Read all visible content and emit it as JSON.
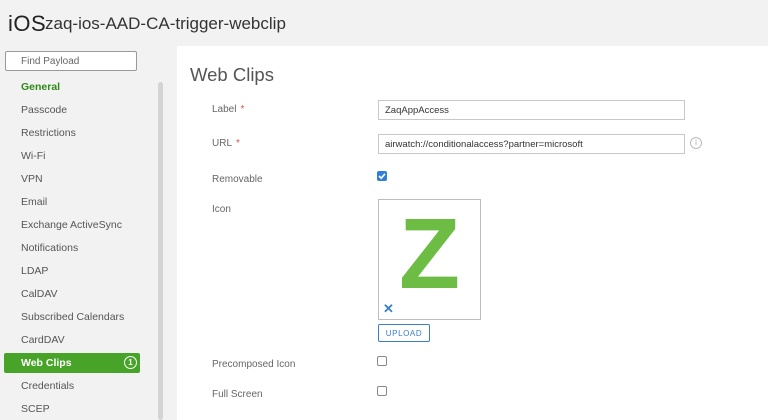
{
  "header": {
    "os_label": "iOS",
    "profile_name": "zaq-ios-AAD-CA-trigger-webclip"
  },
  "sidebar": {
    "search_placeholder": "Find Payload",
    "items": [
      {
        "label": "General"
      },
      {
        "label": "Passcode"
      },
      {
        "label": "Restrictions"
      },
      {
        "label": "Wi-Fi"
      },
      {
        "label": "VPN"
      },
      {
        "label": "Email"
      },
      {
        "label": "Exchange ActiveSync"
      },
      {
        "label": "Notifications"
      },
      {
        "label": "LDAP"
      },
      {
        "label": "CalDAV"
      },
      {
        "label": "Subscribed Calendars"
      },
      {
        "label": "CardDAV"
      },
      {
        "label": "Web Clips",
        "badge": "1"
      },
      {
        "label": "Credentials"
      },
      {
        "label": "SCEP"
      }
    ]
  },
  "main": {
    "title": "Web Clips",
    "fields": {
      "label": {
        "label": "Label",
        "required": "*",
        "value": "ZaqAppAccess"
      },
      "url": {
        "label": "URL",
        "required": "*",
        "value": "airwatch://conditionalaccess?partner=microsoft",
        "info_icon": "info-icon"
      },
      "removable": {
        "label": "Removable",
        "checked": true
      },
      "icon": {
        "label": "Icon",
        "preview_letter": "Z",
        "remove_icon": "close-icon",
        "upload_label": "UPLOAD"
      },
      "precomposed": {
        "label": "Precomposed Icon",
        "checked": false
      },
      "full_screen": {
        "label": "Full Screen",
        "checked": false
      }
    }
  },
  "colors": {
    "active_nav": "#48a428",
    "general_text": "#2e8a16",
    "checkbox_checked": "#2f7fd6",
    "icon_green": "#6dbd45",
    "required": "#d9534f"
  }
}
